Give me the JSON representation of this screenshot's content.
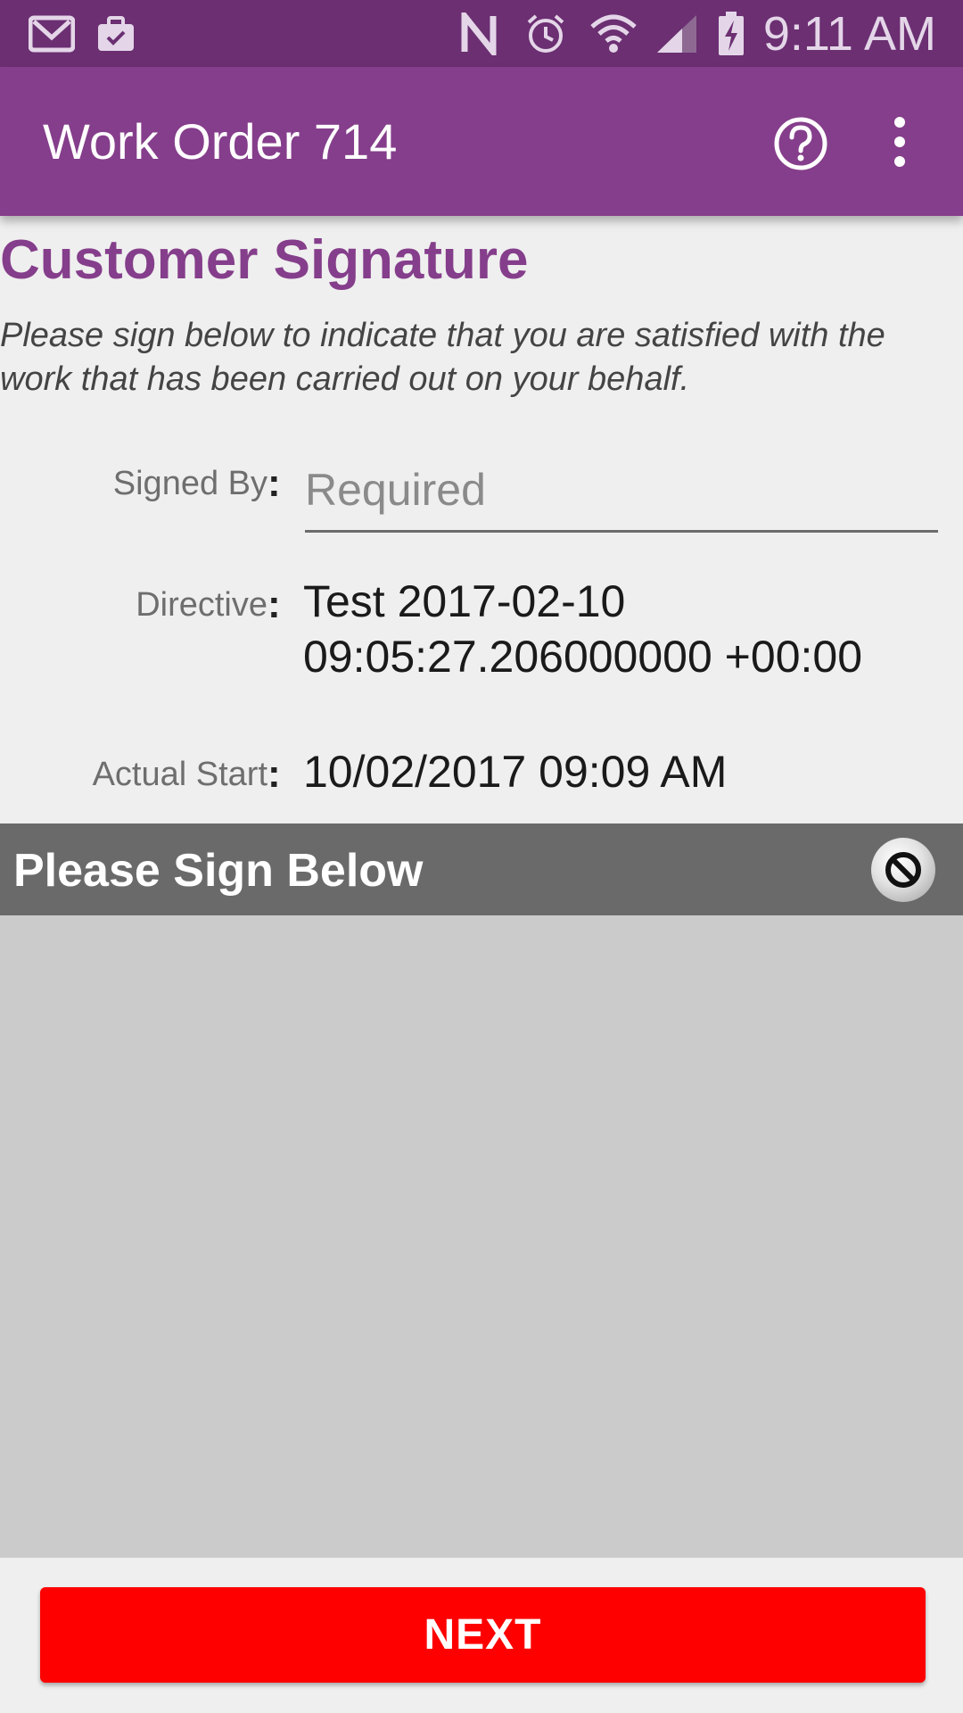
{
  "status_bar": {
    "time": "9:11 AM",
    "icons": [
      "gmail-icon",
      "work-briefcase-icon",
      "nfc-icon",
      "alarm-icon",
      "wifi-icon",
      "signal-icon",
      "battery-charging-icon"
    ]
  },
  "app_bar": {
    "title": "Work Order 714",
    "actions": [
      "help-icon",
      "overflow-menu-icon"
    ]
  },
  "section": {
    "title": "Customer Signature",
    "instructions": "Please sign below to indicate that you are satisfied with the work that has been carried out on your behalf."
  },
  "fields": {
    "signed_by": {
      "label": "Signed By",
      "value": "",
      "placeholder": "Required"
    },
    "directive": {
      "label": "Directive",
      "value": "Test 2017-02-10 09:05:27.206000000 +00:00"
    },
    "actual_start": {
      "label": "Actual Start",
      "value": "10/02/2017 09:09 AM"
    },
    "separator": ":"
  },
  "signature": {
    "header": "Please Sign Below",
    "clear_icon": "clear-signature-icon"
  },
  "footer": {
    "next_label": "NEXT"
  },
  "colors": {
    "status_bar": "#6b2f72",
    "app_bar": "#853e8b",
    "accent": "#853e8b",
    "next_button": "#fe0000",
    "signature_header": "#6a6a6a",
    "signature_pad": "#cbcbcb"
  }
}
